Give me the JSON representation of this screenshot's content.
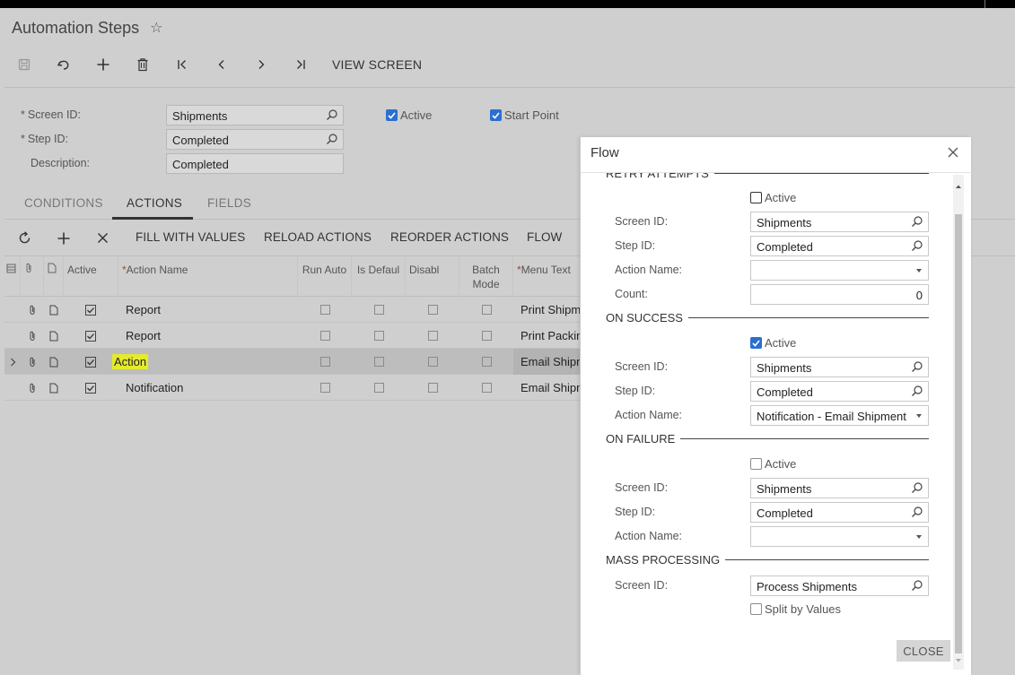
{
  "app": {
    "title": "Automation Steps"
  },
  "toolbar": {
    "view_screen": "VIEW SCREEN"
  },
  "form": {
    "screen_id_label": "Screen ID:",
    "screen_id_value": "Shipments",
    "step_id_label": "Step ID:",
    "step_id_value": "Completed",
    "description_label": "Description:",
    "description_value": "Completed",
    "active_label": "Active",
    "start_point_label": "Start Point",
    "required_mark": "*"
  },
  "tabs": {
    "conditions": "CONDITIONS",
    "actions": "ACTIONS",
    "fields": "FIELDS"
  },
  "gridbar": {
    "fill_with_values": "FILL WITH VALUES",
    "reload_actions": "RELOAD ACTIONS",
    "reorder_actions": "REORDER ACTIONS",
    "flow": "FLOW"
  },
  "grid": {
    "headers": {
      "active": "Active",
      "action_name": "Action Name",
      "run_auto": "Run Auto",
      "is_default": "Is Defaul",
      "disabled": "Disabl",
      "batch_mode": "Batch Mode",
      "menu_text": "Menu Text",
      "required_mark": "*"
    },
    "rows": [
      {
        "action_name": "Report",
        "menu_text": "Print Shipm"
      },
      {
        "action_name": "Report",
        "menu_text": "Print Packin"
      },
      {
        "action_name": "Action",
        "menu_text": "Email Shipm"
      },
      {
        "action_name": "Notification",
        "menu_text": "Email Shipm"
      }
    ]
  },
  "modal": {
    "title": "Flow",
    "retry": {
      "section": "RETRY ATTEMPTS",
      "active_label": "Active",
      "screen_id_label": "Screen ID:",
      "screen_id_value": "Shipments",
      "step_id_label": "Step ID:",
      "step_id_value": "Completed",
      "action_name_label": "Action Name:",
      "action_name_value": "",
      "count_label": "Count:",
      "count_value": "0"
    },
    "on_success": {
      "section": "ON SUCCESS",
      "active_label": "Active",
      "screen_id_label": "Screen ID:",
      "screen_id_value": "Shipments",
      "step_id_label": "Step ID:",
      "step_id_value": "Completed",
      "action_name_label": "Action Name:",
      "action_name_value": "Notification - Email Shipment"
    },
    "on_failure": {
      "section": "ON FAILURE",
      "active_label": "Active",
      "screen_id_label": "Screen ID:",
      "screen_id_value": "Shipments",
      "step_id_label": "Step ID:",
      "step_id_value": "Completed",
      "action_name_label": "Action Name:",
      "action_name_value": ""
    },
    "mass_processing": {
      "section": "MASS PROCESSING",
      "screen_id_label": "Screen ID:",
      "screen_id_value": "Process Shipments",
      "split_label": "Split by Values"
    },
    "close_label": "CLOSE"
  },
  "colors": {
    "accent": "#2a6fd1",
    "highlight": "#e4ea2c",
    "backdrop": "#cfcfcf"
  }
}
